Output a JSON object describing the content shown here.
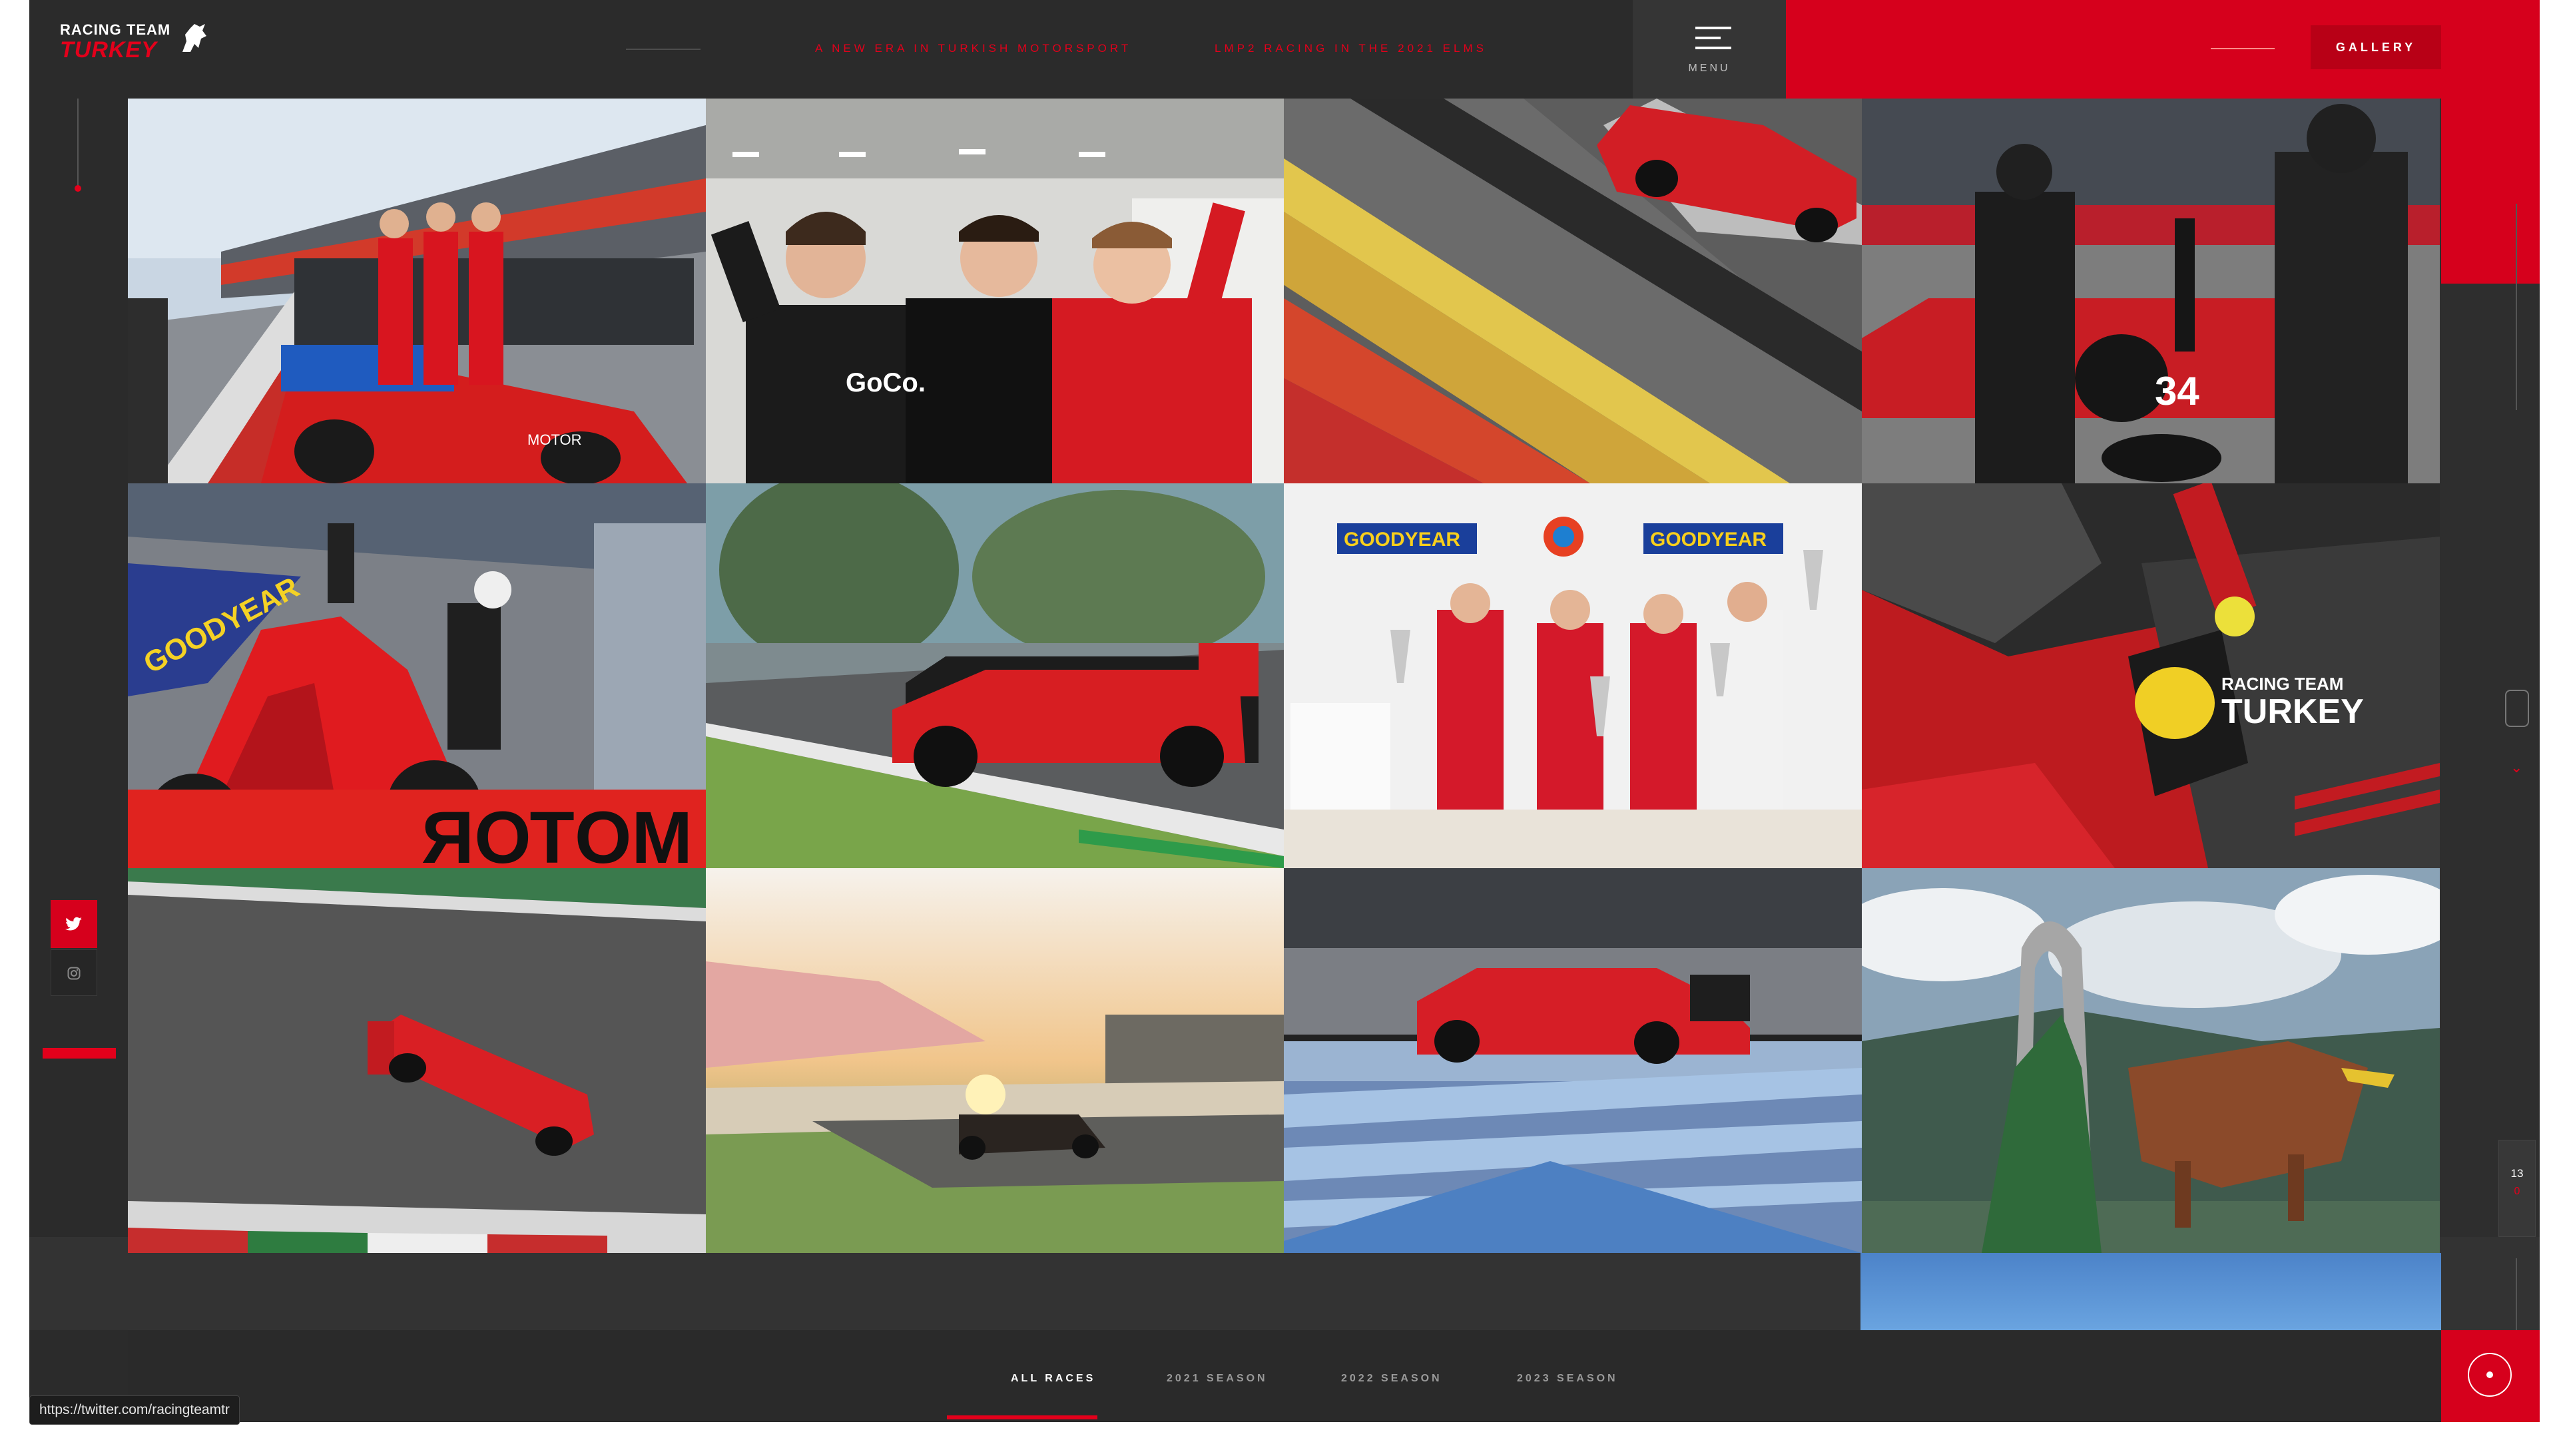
{
  "brand": {
    "line1": "RACING TEAM",
    "line2": "TURKEY"
  },
  "nav": {
    "link1": "A NEW ERA IN TURKISH MOTORSPORT",
    "link2": "LMP2 RACING IN THE 2021 ELMS"
  },
  "menu": {
    "label": "MENU"
  },
  "gallery_button": "GALLERY",
  "photos": [
    {
      "caption": "Drivers celebrating on car on pit lane"
    },
    {
      "caption": "Team members celebrating in garage"
    },
    {
      "caption": "Car at speed over kerb"
    },
    {
      "caption": "Pit crew standing by car"
    },
    {
      "caption": "Pit stop from above"
    },
    {
      "caption": "Car racing at Monza"
    },
    {
      "caption": "Podium ceremony with trophies"
    },
    {
      "caption": "Driver in cockpit"
    },
    {
      "caption": "Car at Monza aerial"
    },
    {
      "caption": "Car at sunset"
    },
    {
      "caption": "Car at Paul Ricard"
    },
    {
      "caption": "Red Bull Ring bull statue"
    }
  ],
  "sponsor_text": {
    "goodyear": "GOODYEAR",
    "motor": "MOTOR",
    "team_badge_1": "RACING TEAM",
    "team_badge_2": "TURKEY"
  },
  "filters": [
    "ALL RACES",
    "2021 SEASON",
    "2022 SEASON",
    "2023 SEASON"
  ],
  "counter": {
    "current": "13",
    "next": "0"
  },
  "status_url": "https://twitter.com/racingteamtr",
  "icons": {
    "twitter": "twitter-icon",
    "instagram": "instagram-icon",
    "scroll": "scroll-mouse-icon",
    "arrow": "chevron-down-icon"
  },
  "colors": {
    "accent": "#e3001b",
    "panel": "#d6001c",
    "bg": "#2e2e2e"
  }
}
